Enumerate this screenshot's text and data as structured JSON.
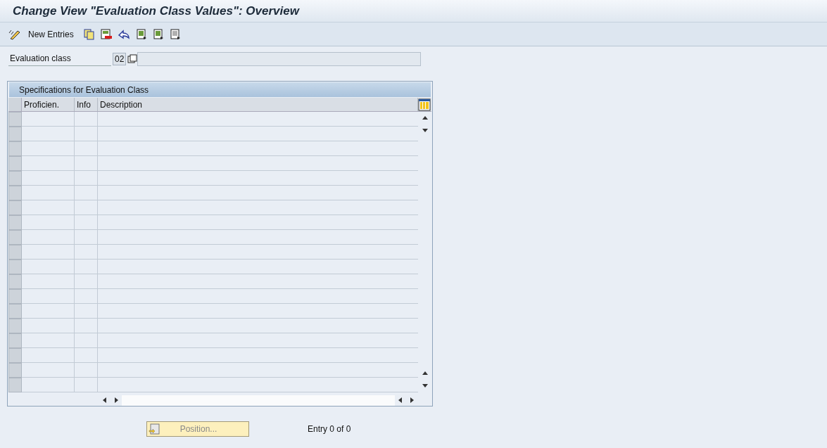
{
  "window": {
    "title": "Change View \"Evaluation Class Values\": Overview"
  },
  "toolbar": {
    "new_entries": "New Entries"
  },
  "evaluation_class": {
    "label": "Evaluation class",
    "value": "02"
  },
  "table": {
    "title": "Specifications for Evaluation Class",
    "columns": [
      "Proficien.",
      "Info",
      "Description"
    ]
  },
  "footer": {
    "position_button": {
      "label": "Position...",
      "disabled": true
    },
    "entry_info": "Entry 0 of 0"
  }
}
